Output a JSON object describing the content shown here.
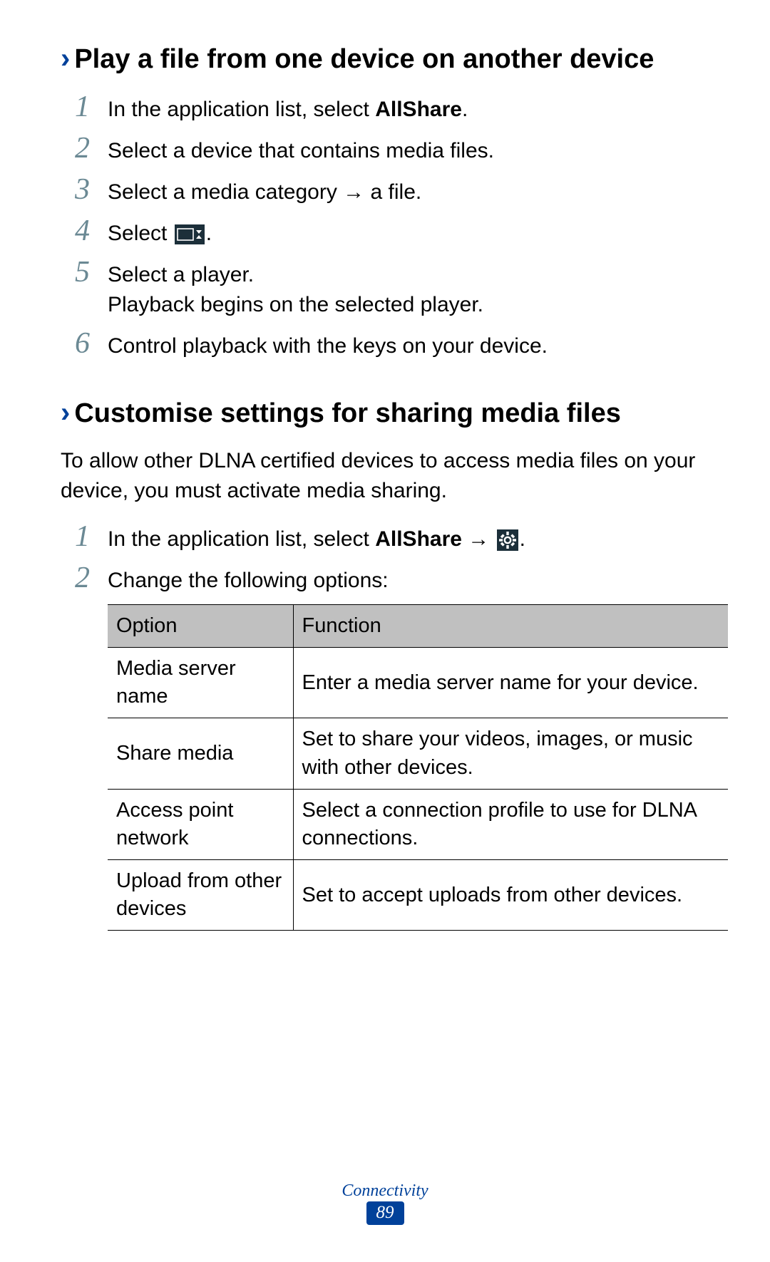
{
  "section1": {
    "heading": "Play a file from one device on another device",
    "steps": [
      {
        "num": "1",
        "pre": "In the application list, select ",
        "bold": "AllShare",
        "post": "."
      },
      {
        "num": "2",
        "text": "Select a device that contains media files."
      },
      {
        "num": "3",
        "text": "Select a media category → a file."
      },
      {
        "num": "4",
        "pre": "Select ",
        "icon": "cast-icon",
        "post": "."
      },
      {
        "num": "5",
        "line1": "Select a player.",
        "line2": "Playback begins on the selected player."
      },
      {
        "num": "6",
        "text": "Control playback with the keys on your device."
      }
    ]
  },
  "section2": {
    "heading": "Customise settings for sharing media files",
    "intro": "To allow other DLNA certified devices to access media files on your device, you must activate media sharing.",
    "steps": [
      {
        "num": "1",
        "pre": "In the application list, select ",
        "bold": "AllShare",
        "arrow": " → ",
        "icon": "settings-gear-icon",
        "post": "."
      },
      {
        "num": "2",
        "text": "Change the following options:"
      }
    ],
    "table": {
      "headers": {
        "option": "Option",
        "function": "Function"
      },
      "rows": [
        {
          "option": "Media server name",
          "function": "Enter a media server name for your device."
        },
        {
          "option": "Share media",
          "function": "Set to share your videos, images, or music with other devices."
        },
        {
          "option": "Access point network",
          "function": "Select a connection profile to use for DLNA connections."
        },
        {
          "option": "Upload from other devices",
          "function": "Set to accept uploads from other devices."
        }
      ]
    }
  },
  "footer": {
    "section_label": "Connectivity",
    "page_number": "89"
  }
}
